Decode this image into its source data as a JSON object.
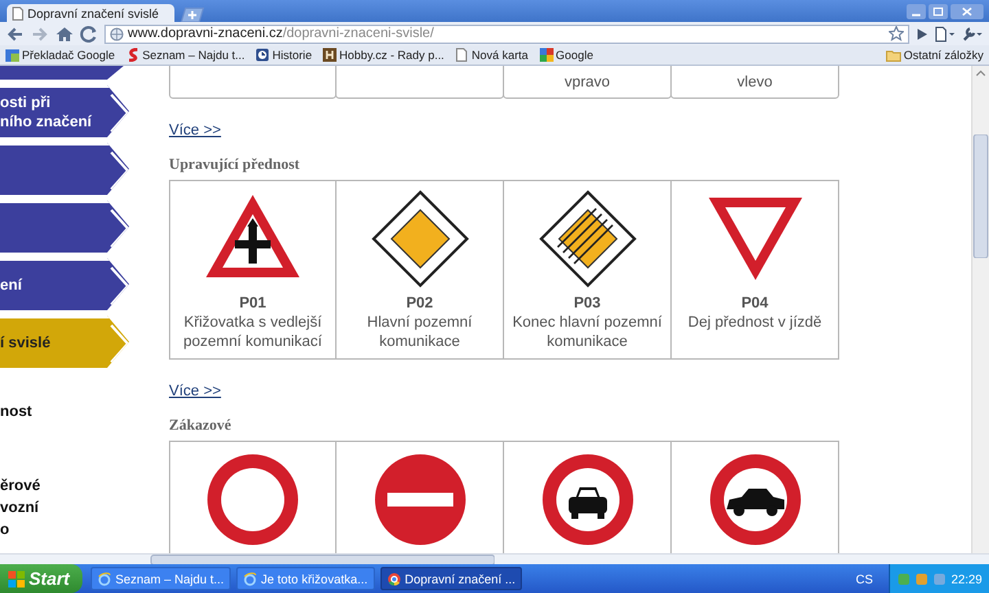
{
  "browser": {
    "tabs": [
      {
        "title": "Dopravní značení svislé",
        "selected": true
      }
    ],
    "address": {
      "domain": "www.dopravni-znaceni.cz",
      "path": "/dopravni-znaceni-svisle/"
    },
    "bookmarks": [
      {
        "label": "Překladač Google",
        "kind": "translate"
      },
      {
        "label": "Seznam – Najdu t...",
        "kind": "seznam"
      },
      {
        "label": "Historie",
        "kind": "history"
      },
      {
        "label": "Hobby.cz - Rady p...",
        "kind": "hobby"
      },
      {
        "label": "Nová karta",
        "kind": "page"
      },
      {
        "label": "Google",
        "kind": "google"
      }
    ],
    "other_bookmarks": "Ostatní záložky"
  },
  "sidebar": {
    "items": [
      {
        "selected": false
      },
      {
        "lines": [
          "osti při",
          "ního značení"
        ],
        "selected": false
      },
      {
        "selected": false
      },
      {
        "selected": false
      },
      {
        "lines": [
          "ení"
        ],
        "selected": false
      },
      {
        "lines": [
          "í svislé"
        ],
        "selected": true
      }
    ],
    "links": [
      {
        "text": "nost",
        "kind": "gap-after"
      },
      {
        "text": "ěrové",
        "kind": "plain"
      },
      {
        "text": "vozní",
        "kind": "plain"
      },
      {
        "text": "o",
        "kind": "plain"
      }
    ]
  },
  "content": {
    "top_cards": [
      {
        "kind": "blank"
      },
      {
        "kind": "blank"
      },
      {
        "kind": "captioned",
        "caption": "vpravo"
      },
      {
        "kind": "captioned",
        "caption": "vlevo"
      }
    ],
    "sections": [
      {
        "more_link": "Více >>",
        "heading": "Upravující přednost",
        "cards": [
          {
            "kind": "crossroad",
            "code": "P01",
            "caption": "Křižovatka s vedlejší pozemní komunikací"
          },
          {
            "kind": "main-road",
            "code": "P02",
            "caption": "Hlavní pozemní komunikace"
          },
          {
            "kind": "end-main-road",
            "code": "P03",
            "caption": "Konec hlavní pozemní komunikace"
          },
          {
            "kind": "yield",
            "code": "P04",
            "caption": "Dej přednost v jízdě"
          }
        ]
      },
      {
        "more_link": "Více >>",
        "heading": "Zákazové",
        "cards": [
          {
            "kind": "ring"
          },
          {
            "kind": "no-entry"
          },
          {
            "kind": "car-front"
          },
          {
            "kind": "car-side"
          }
        ]
      }
    ]
  },
  "taskbar": {
    "start": "Start",
    "tasks": [
      {
        "label": "Seznam – Najdu t...",
        "kind": "ie",
        "selected": false
      },
      {
        "label": "Je toto křižovatka...",
        "kind": "ie",
        "selected": false
      },
      {
        "label": "Dopravní značení ...",
        "kind": "chrome",
        "selected": true
      }
    ],
    "language": "CS",
    "clock": "22:29"
  }
}
